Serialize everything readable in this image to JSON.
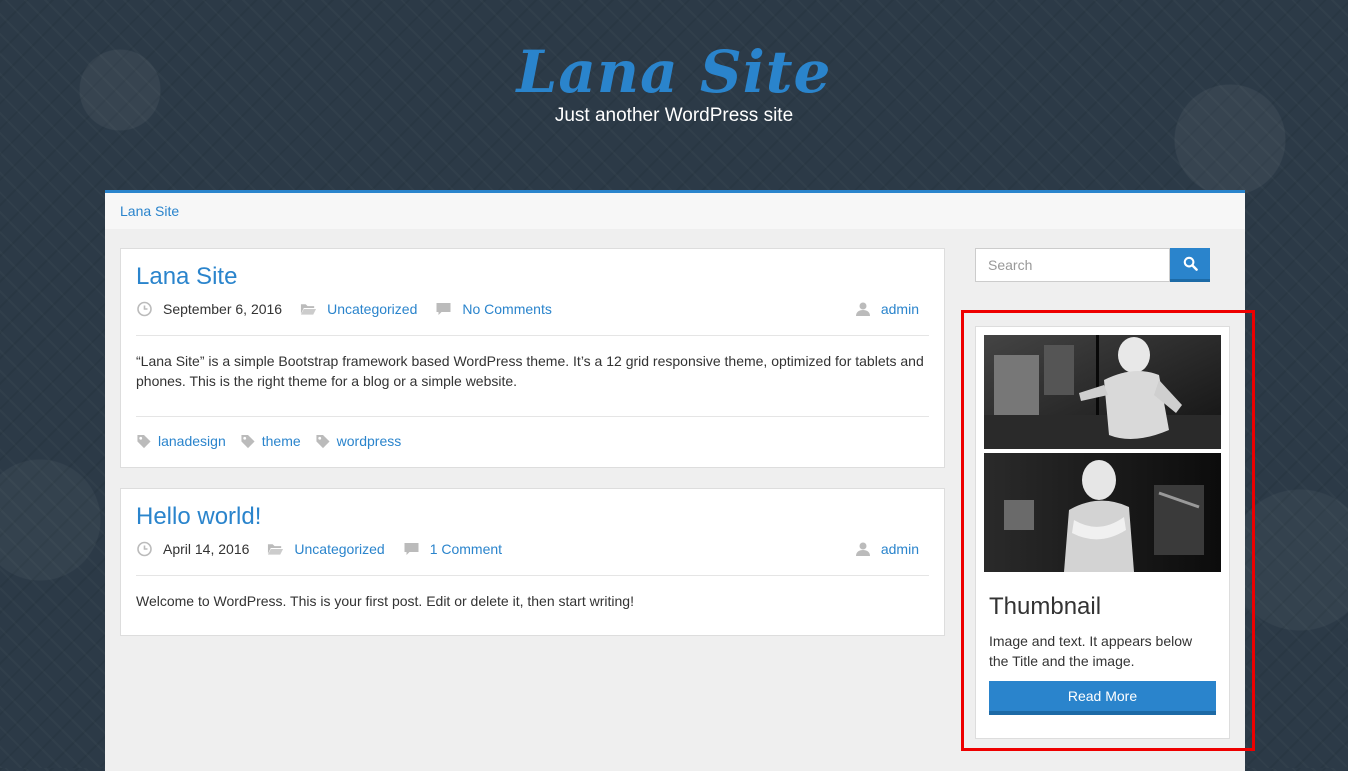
{
  "header": {
    "site_title": "Lana Site",
    "tagline": "Just another WordPress site"
  },
  "breadcrumb": {
    "label": "Lana Site"
  },
  "posts": [
    {
      "title": "Lana Site",
      "date": "September 6, 2016",
      "category": "Uncategorized",
      "comments": "No Comments",
      "author": "admin",
      "excerpt": "“Lana Site” is a simple Bootstrap framework based WordPress theme. It’s a 12 grid responsive theme, optimized for tablets and phones. This is the right theme for a blog or a simple website.",
      "tags": [
        "lanadesign",
        "theme",
        "wordpress"
      ]
    },
    {
      "title": "Hello world!",
      "date": "April 14, 2016",
      "category": "Uncategorized",
      "comments": "1 Comment",
      "author": "admin",
      "excerpt": "Welcome to WordPress. This is your first post. Edit or delete it, then start writing!"
    }
  ],
  "sidebar": {
    "search": {
      "placeholder": "Search",
      "button_icon": "search-icon"
    },
    "widget": {
      "title": "Thumbnail",
      "text": "Image and text. It appears below the Title and the image.",
      "button": "Read More"
    }
  },
  "colors": {
    "accent": "#2a84cc",
    "background": "#2c3a47",
    "content_bg": "#efefef",
    "highlight": "#e00000"
  }
}
